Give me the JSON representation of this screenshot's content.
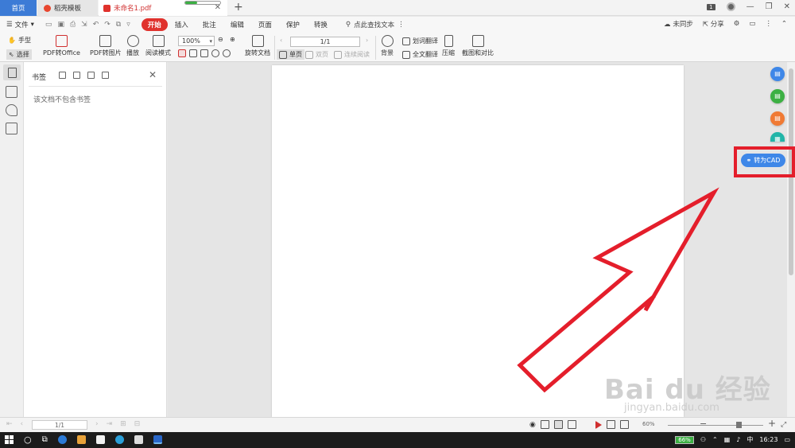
{
  "titlebar": {
    "tabs": [
      {
        "label": "首页"
      },
      {
        "label": "稻壳模板"
      },
      {
        "label": "未命名1.pdf"
      }
    ],
    "page_badge": "1",
    "download_progress": 0.35
  },
  "menu": {
    "file_label": "文件",
    "tabs": [
      "开始",
      "插入",
      "批注",
      "编辑",
      "页面",
      "保护",
      "转换"
    ],
    "active_tab": "开始",
    "search_label": "点此查找文本",
    "sync_label": "未同步",
    "share_label": "分享"
  },
  "toolbar": {
    "hand": "手型",
    "select": "选择",
    "pdf_to_office": "PDF转Office",
    "pdf_to_image": "PDF转图片",
    "play": "播放",
    "read_mode": "阅读模式",
    "zoom_value": "100%",
    "rotate": "旋转文档",
    "page_value": "1/1",
    "single_page": "单页",
    "double_page": "双页",
    "continuous": "连续阅读",
    "background": "背景",
    "word_translate": "划词翻译",
    "full_translate": "全文翻译",
    "compress": "压缩",
    "screenshot_compare": "截图和对比"
  },
  "panel": {
    "title": "书签",
    "empty_message": "该文档不包含书签"
  },
  "floating": {
    "cad_label": "转为CAD",
    "colors": [
      "#3e87e8",
      "#3cb043",
      "#f07a34",
      "#21b5a8"
    ],
    "highlight_color": "#e41e2b"
  },
  "statusbar": {
    "page_value": "1/1",
    "zoom_pct": "60%"
  },
  "taskbar": {
    "battery": "66%",
    "ime": "中",
    "time": "16:23"
  },
  "watermark": {
    "main": "Bai du 经验",
    "sub": "jingyan.baidu.com"
  }
}
